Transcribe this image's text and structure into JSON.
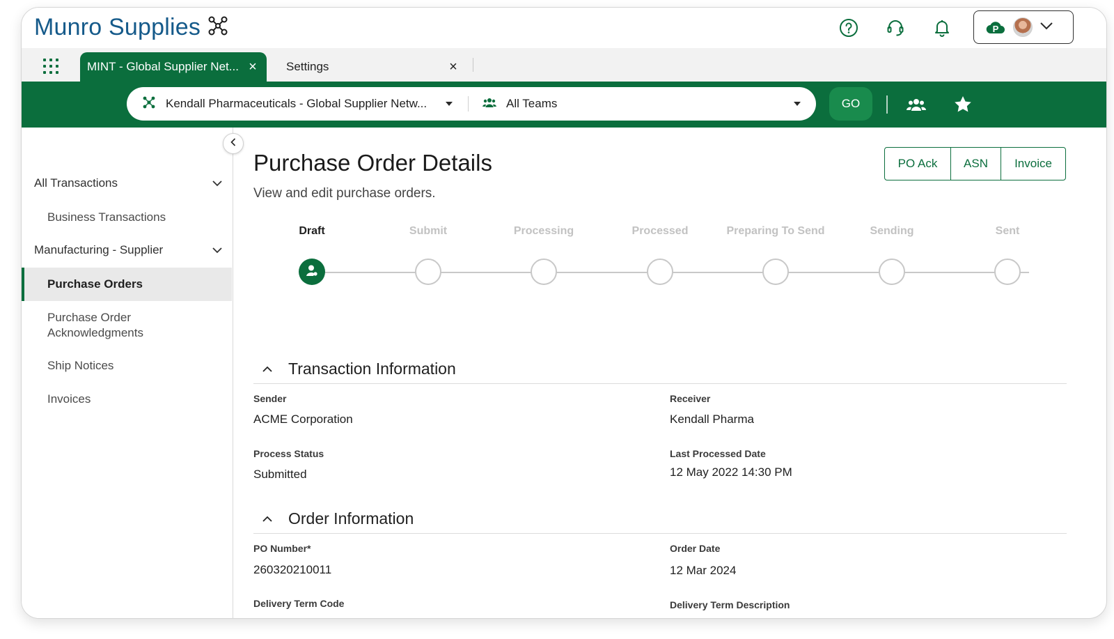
{
  "app": {
    "brand": "Munro Supplies"
  },
  "header": {
    "icons": [
      "help-icon",
      "support-headset-icon",
      "notification-bell-icon"
    ],
    "account": {
      "badge_letter": "P"
    }
  },
  "tabs": [
    {
      "label": "MINT - Global Supplier Net...",
      "close": "×"
    },
    {
      "label": "Settings",
      "close": "×"
    }
  ],
  "filter_bar": {
    "organization": "Kendall Pharmaceuticals - Global Supplier Netw...",
    "team": "All Teams",
    "go_label": "GO"
  },
  "sidebar": {
    "groups": [
      {
        "label": "All Transactions"
      },
      {
        "label": "Manufacturing - Supplier"
      }
    ],
    "items": [
      {
        "label": "Business Transactions"
      },
      {
        "label": "Purchase Orders"
      },
      {
        "label": "Purchase Order Acknowledgments"
      },
      {
        "label": "Ship Notices"
      },
      {
        "label": "Invoices"
      }
    ]
  },
  "page": {
    "title": "Purchase Order Details",
    "subtitle": "View and edit purchase orders.",
    "actions": [
      "PO Ack",
      "ASN",
      "Invoice"
    ]
  },
  "stepper": {
    "steps": [
      "Draft",
      "Submit",
      "Processing",
      "Processed",
      "Preparing To Send",
      "Sending",
      "Sent"
    ],
    "current_index": 0
  },
  "transaction_info": {
    "title": "Transaction Information",
    "sender_label": "Sender",
    "sender": "ACME Corporation",
    "receiver_label": "Receiver",
    "receiver": "Kendall Pharma",
    "process_status_label": "Process Status",
    "process_status": "Submitted",
    "last_processed_label": "Last Processed Date",
    "last_processed": "12 May 2022 14:30 PM"
  },
  "order_info": {
    "title": "Order Information",
    "po_number_label": "PO Number*",
    "po_number": "260320210011",
    "order_date_label": "Order Date",
    "order_date": "12 Mar 2024",
    "delivery_term_code_label": "Delivery Term Code",
    "delivery_term_desc_label": "Delivery Term Description"
  },
  "colors": {
    "primary_green": "#0b6e3d",
    "brand_blue": "#155a8a",
    "go_green": "#198b4d"
  }
}
